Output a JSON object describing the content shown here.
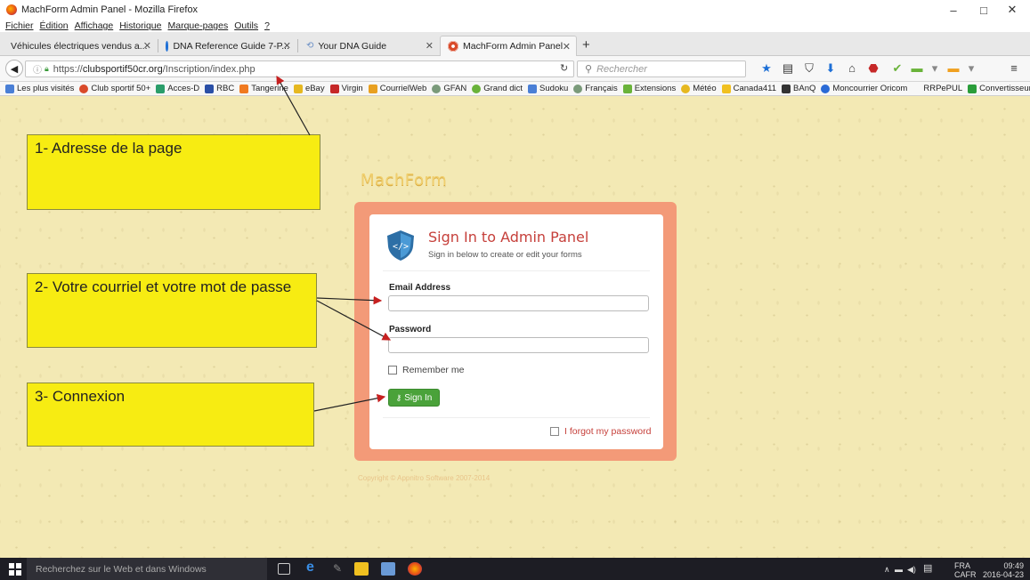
{
  "window": {
    "title": "MachForm Admin Panel - Mozilla Firefox",
    "controls": {
      "minimize": "–",
      "maximize": "□",
      "close": "✕"
    }
  },
  "menu": [
    "Fichier",
    "Édition",
    "Affichage",
    "Historique",
    "Marque-pages",
    "Outils",
    "?"
  ],
  "tabs": [
    {
      "label": "Véhicules électriques vendus a...",
      "active": false
    },
    {
      "label": "DNA Reference Guide 7-P...",
      "active": false
    },
    {
      "label": "Your DNA Guide",
      "active": false
    },
    {
      "label": "MachForm Admin Panel",
      "active": true
    }
  ],
  "navbar": {
    "url_prefix": "https://",
    "url_domain": "clubsportif50cr.org",
    "url_path": "/Inscription/index.php",
    "search_placeholder": "Rechercher"
  },
  "bookmarks": [
    "Les plus visités",
    "Club sportif 50+",
    "Acces-D",
    "RBC",
    "Tangerine",
    "eBay",
    "Virgin",
    "CourrielWeb",
    "GFAN",
    "Grand dict",
    "Sudoku",
    "Français",
    "Extensions",
    "Météo",
    "Canada411",
    "BAnQ",
    "Moncourrier Oricom",
    "RRPePUL",
    "Convertisseur ePub",
    "»"
  ],
  "page": {
    "logo": "MachForm",
    "title": "Sign In to Admin Panel",
    "subtitle": "Sign in below to create or edit your forms",
    "email_label": "Email Address",
    "email_value": "",
    "password_label": "Password",
    "password_value": "",
    "remember_label": "Remember me",
    "signin_label": "Sign In",
    "forgot_label": "I forgot my password",
    "copyright": "Copyright © Appnitro Software 2007-2014"
  },
  "callouts": {
    "address": "1- Adresse de la page",
    "credentials": "2- Votre courriel et votre mot de passe",
    "connect": "3- Connexion"
  },
  "taskbar": {
    "search_placeholder": "Recherchez sur le Web et dans Windows",
    "lang_top": "FRA",
    "lang_bottom": "CAFR",
    "time": "09:49",
    "date": "2016-04-23"
  },
  "colors": {
    "page_bg": "#f3e9b4",
    "panel_border": "#f39a78",
    "title_red": "#c6403b",
    "signin_green": "#4aa23a",
    "callout_yellow": "#f7ec12"
  }
}
